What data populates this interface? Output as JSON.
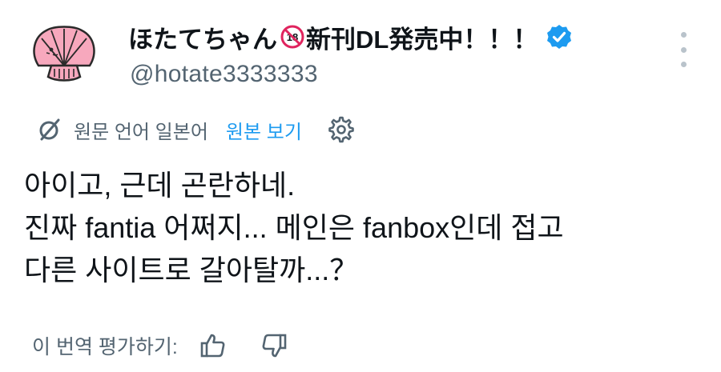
{
  "author": {
    "avatar_icon": "scallop-shell-avatar-icon",
    "display_name_prefix": "ほたてちゃん",
    "r18_badge_text": "18",
    "display_name_suffix": "新刊DL発売中！！！",
    "verified_icon": "verified-badge-icon",
    "handle": "@hotate3333333"
  },
  "more_icon": "more-options-icon",
  "translation": {
    "icon": "translate-icon",
    "source_language": "원문 언어 일본어",
    "show_original": "원본 보기",
    "settings_icon": "gear-icon"
  },
  "tweet": {
    "lines": [
      "아이고, 근데 곤란하네.",
      "진짜 fantia 어쩌지... 메인은 fanbox인데 접고",
      "다른 사이트로 갈아탈까...？"
    ]
  },
  "rating": {
    "label": "이 번역 평가하기:",
    "thumbs_up_icon": "thumbs-up-icon",
    "thumbs_down_icon": "thumbs-down-icon"
  },
  "colors": {
    "text_primary": "#0f1419",
    "text_secondary": "#536471",
    "link": "#1d9bf0",
    "verified": "#1d9bf0",
    "avatar_pink": "#f7a8bd",
    "r18_red": "#e0245e"
  }
}
